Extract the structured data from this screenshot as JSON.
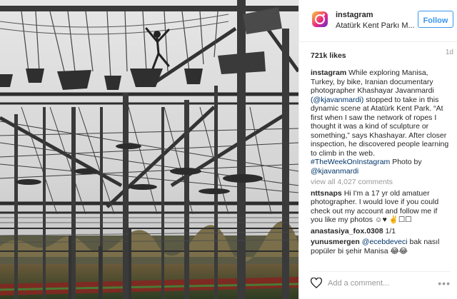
{
  "header": {
    "username": "instagram",
    "location": "Atatürk Kent Parkı M...",
    "follow_label": "Follow"
  },
  "stats": {
    "likes": "721k likes",
    "age": "1d"
  },
  "caption": {
    "user": "instagram",
    "text_1": "While exploring Manisa, Turkey, by bike, Iranian documentary photographer Khashayar Javanmardi",
    "mention_1": "(@kjavanmardi)",
    "text_2": "stopped to take in this dynamic scene at Atatürk Kent Park. “At first when I saw the network of ropes I thought it was a kind of sculpture or something,” says Khashayar. After closer inspection, he discovered people learning to climb in the web.",
    "hashtag": "#TheWeekOnInstagram",
    "photo_by": "Photo by",
    "mention_2": "@kjavanmardi"
  },
  "view_all": "view all 4,027 comments",
  "comments": [
    {
      "user": "nttsnaps",
      "text": "Hi I'm a 17 yr old amatuer photographer. I would love if you could check out my account and follow me if you like my photos ☺♥ ✌️☐☐"
    },
    {
      "user": "anastasiya_fox.0308",
      "text": "1/1"
    },
    {
      "user": "yunusmergen",
      "mention": "@ecebdeveci",
      "text": "bak nasıl popüler bi şehir Manisa 😂😂"
    }
  ],
  "composer": {
    "placeholder": "Add a comment...",
    "more": "•••"
  },
  "icons": {
    "brand": "instagram-logo-icon",
    "like": "heart-outline-icon",
    "options": "more-options-icon"
  },
  "colors": {
    "link": "#003569",
    "follow": "#3897f0",
    "muted": "#999999"
  }
}
